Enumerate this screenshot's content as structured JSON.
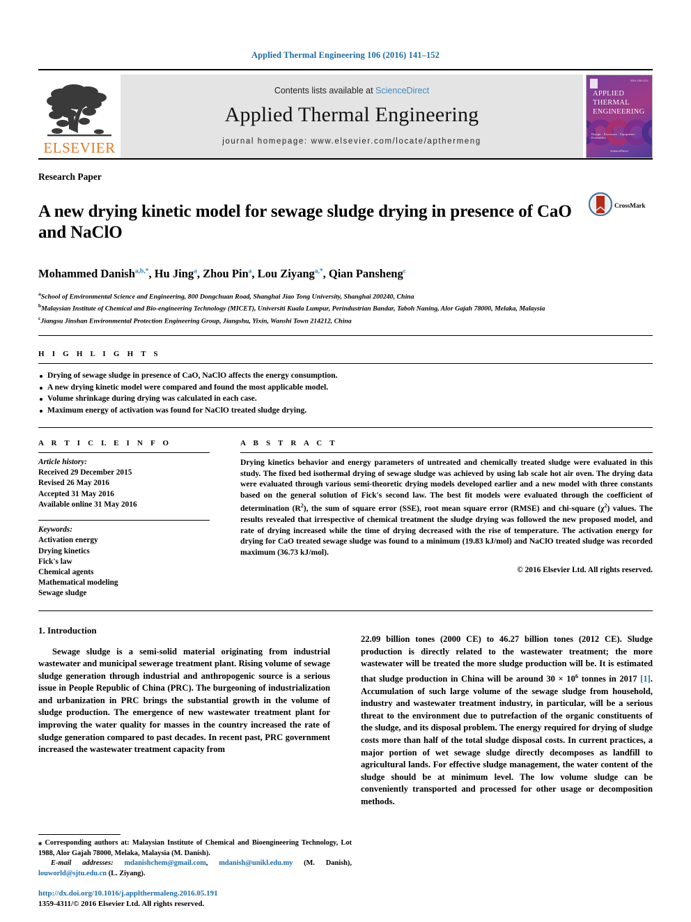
{
  "running_head": "Applied Thermal Engineering 106 (2016) 141–152",
  "masthead": {
    "contents_prefix": "Contents lists available at ",
    "sciencedirect": "ScienceDirect",
    "journal_title": "Applied Thermal Engineering",
    "homepage": "journal homepage: www.elsevier.com/locate/apthermeng",
    "publisher_word": "ELSEVIER",
    "accent_orange": "#E87722",
    "link_blue": "#1a6ca8",
    "band_gray": "#e4e4e4",
    "cover": {
      "issn": "ISSN 1359-4311",
      "line1": "APPLIED",
      "line2": "THERMAL",
      "line3": "ENGINEERING",
      "subtitle": "Design · Processes · Equipment · Economics",
      "footer": "ScienceDirect"
    }
  },
  "article": {
    "type": "Research Paper",
    "title": "A new drying kinetic model for sewage sludge drying in presence of CaO and NaClO",
    "crossmark_label": "CrossMark",
    "authors": [
      {
        "name": "Mohammed Danish",
        "sup": "a,b,*"
      },
      {
        "name": "Hu Jing",
        "sup": "a"
      },
      {
        "name": "Zhou Pin",
        "sup": "a"
      },
      {
        "name": "Lou Ziyang",
        "sup": "a,*"
      },
      {
        "name": "Qian Pansheng",
        "sup": "c"
      }
    ],
    "affiliations": [
      {
        "sup": "a",
        "text": "School of Environmental Science and Engineering, 800 Dongchuan Road, Shanghai Jiao Tong University, Shanghai 200240, China"
      },
      {
        "sup": "b",
        "text": "Malaysian Institute of Chemical and Bio-engineering Technology (MICET), Universiti Kuala Lumpur, Perindustrian Bandar, Taboh Naning, Alor Gajah 78000, Melaka, Malaysia"
      },
      {
        "sup": "c",
        "text": "Jiangsu Jinshan Environmental Protection Engineering Group, Jiangshu, Yixin, Wanshi Town 214212, China"
      }
    ]
  },
  "highlights": {
    "heading": "H I G H L I G H T S",
    "items": [
      "Drying of sewage sludge in presence of CaO, NaClO affects the energy consumption.",
      "A new drying kinetic model were compared and found the most applicable model.",
      "Volume shrinkage during drying was calculated in each case.",
      "Maximum energy of activation was found for NaClO treated sludge drying."
    ]
  },
  "article_info": {
    "heading": "A R T I C L E    I N F O",
    "history_label": "Article history:",
    "history": [
      "Received 29 December 2015",
      "Revised 26 May 2016",
      "Accepted 31 May 2016",
      "Available online 31 May 2016"
    ],
    "keywords_label": "Keywords:",
    "keywords": [
      "Activation energy",
      "Drying kinetics",
      "Fick's law",
      "Chemical agents",
      "Mathematical modeling",
      "Sewage sludge"
    ]
  },
  "abstract": {
    "heading": "A B S T R A C T",
    "paragraph_1": "Drying kinetics behavior and energy parameters of untreated and chemically treated sludge were evaluated in this study. The fixed bed isothermal drying of sewage sludge was achieved by using lab scale hot air oven. The drying data were evaluated through various semi-theoretic drying models developed earlier and a new model with three constants based on the general solution of Fick's second law. The best fit models were evaluated through the coefficient of determination (R",
    "sup_1": "2",
    "paragraph_2": "), the sum of square error (SSE), root mean square error (RMSE) and chi-square (χ",
    "sup_2": "2",
    "paragraph_3": ") values. The results revealed that irrespective of chemical treatment the sludge drying was followed the new proposed model, and rate of drying increased while the time of drying decreased with the rise of temperature. The activation energy for drying for CaO treated sewage sludge was found to a minimum (19.83 kJ/mol) and NaClO treated sludge was recorded maximum (36.73 kJ/mol).",
    "copyright": "© 2016 Elsevier Ltd. All rights reserved."
  },
  "body": {
    "section_heading": "1. Introduction",
    "left_paragraph": "Sewage sludge is a semi-solid material originating from industrial wastewater and municipal sewerage treatment plant. Rising volume of sewage sludge generation through industrial and anthropogenic source is a serious issue in People Republic of China (PRC). The burgeoning of industrialization and urbanization in PRC brings the substantial growth in the volume of sludge production. The emergence of new wastewater treatment plant for improving the water quality for masses in the country increased the rate of sludge generation compared to past decades. In recent past, PRC government increased the wastewater treatment capacity from",
    "right_paragraph_a": "22.09 billion tones (2000 CE) to 46.27 billion tones (2012 CE). Sludge production is directly related to the wastewater treatment; the more wastewater will be treated the more sludge production will be. It is estimated that sludge production in China will be around 30 × 10",
    "right_exp": "6",
    "right_paragraph_b": " tonnes in 2017 ",
    "right_ref": "[1]",
    "right_paragraph_c": ". Accumulation of such large volume of the sewage sludge from household, industry and wastewater treatment industry, in particular, will be a serious threat to the environment due to putrefaction of the organic constituents of the sludge, and its disposal problem. The energy required for drying of sludge costs more than half of the total sludge disposal costs. In current practices, a major portion of wet sewage sludge directly decomposes as landfill to agricultural lands. For effective sludge management, the water content of the sludge should be at minimum level. The low volume sludge can be conveniently transported and processed for other usage or decomposition methods."
  },
  "footnote": {
    "star": "⁎",
    "corresponding": "Corresponding authors at: Malaysian Institute of Chemical and Bioengineering Technology, Lot 1988, Alor Gajah 78000, Melaka, Malaysia (M. Danish).",
    "email_label": "E-mail addresses:",
    "email_1": "mdanishchem@gmail.com",
    "email_2": "mdanish@unikl.edu.my",
    "email_1_owner": "(M. Danish),",
    "email_3": "louworld@sjtu.edu.cn",
    "email_3_owner": "(L. Ziyang)."
  },
  "footer": {
    "doi": "http://dx.doi.org/10.1016/j.applthermaleng.2016.05.191",
    "issn_line": "1359-4311/© 2016 Elsevier Ltd. All rights reserved."
  }
}
